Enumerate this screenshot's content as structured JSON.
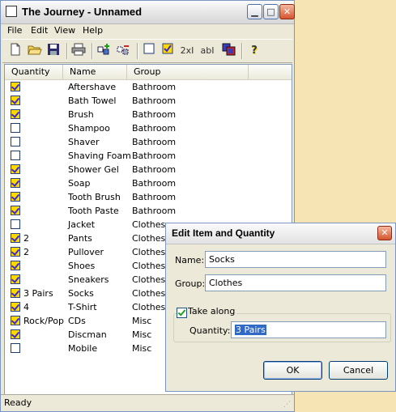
{
  "main_window": {
    "title": "The Journey - Unnamed",
    "controls": [
      "▁",
      "□",
      "✕"
    ]
  },
  "menu": [
    "File",
    "Edit",
    "View",
    "Help"
  ],
  "toolbar": {
    "icons": [
      "new-document-icon",
      "open-folder-icon",
      "save-icon",
      "print-icon",
      "add-items-icon",
      "remove-items-icon",
      "uncheck-all-icon",
      "check-all-icon",
      "quantity-icon",
      "rename-icon",
      "database-icon",
      "help-icon"
    ],
    "quantity_label": "2x",
    "rename_label": "ab",
    "help_label": "?"
  },
  "list": {
    "columns": [
      "Quantity",
      "Name",
      "Group"
    ],
    "rows": [
      {
        "checked": true,
        "quantity": "",
        "name": "Aftershave",
        "group": "Bathroom"
      },
      {
        "checked": true,
        "quantity": "",
        "name": "Bath Towel",
        "group": "Bathroom"
      },
      {
        "checked": true,
        "quantity": "",
        "name": "Brush",
        "group": "Bathroom"
      },
      {
        "checked": false,
        "quantity": "",
        "name": "Shampoo",
        "group": "Bathroom"
      },
      {
        "checked": false,
        "quantity": "",
        "name": "Shaver",
        "group": "Bathroom"
      },
      {
        "checked": false,
        "quantity": "",
        "name": "Shaving Foam",
        "group": "Bathroom"
      },
      {
        "checked": true,
        "quantity": "",
        "name": "Shower Gel",
        "group": "Bathroom"
      },
      {
        "checked": true,
        "quantity": "",
        "name": "Soap",
        "group": "Bathroom"
      },
      {
        "checked": true,
        "quantity": "",
        "name": "Tooth Brush",
        "group": "Bathroom"
      },
      {
        "checked": true,
        "quantity": "",
        "name": "Tooth Paste",
        "group": "Bathroom"
      },
      {
        "checked": false,
        "quantity": "",
        "name": "Jacket",
        "group": "Clothes"
      },
      {
        "checked": true,
        "quantity": "2",
        "name": "Pants",
        "group": "Clothes"
      },
      {
        "checked": true,
        "quantity": "2",
        "name": "Pullover",
        "group": "Clothes"
      },
      {
        "checked": true,
        "quantity": "",
        "name": "Shoes",
        "group": "Clothes"
      },
      {
        "checked": true,
        "quantity": "",
        "name": "Sneakers",
        "group": "Clothes"
      },
      {
        "checked": true,
        "quantity": "3 Pairs",
        "name": "Socks",
        "group": "Clothes"
      },
      {
        "checked": true,
        "quantity": "4",
        "name": "T-Shirt",
        "group": "Clothes"
      },
      {
        "checked": true,
        "quantity": "Rock/Pop",
        "name": "CDs",
        "group": "Misc"
      },
      {
        "checked": true,
        "quantity": "",
        "name": "Discman",
        "group": "Misc"
      },
      {
        "checked": false,
        "quantity": "",
        "name": "Mobile",
        "group": "Misc"
      }
    ]
  },
  "status": "Ready",
  "dialog": {
    "title": "Edit Item and Quantity",
    "close_label": "✕",
    "name_label": "Name:",
    "name_value": "Socks",
    "group_label": "Group:",
    "group_value": "Clothes",
    "take_along_label": "Take along",
    "take_along_checked": true,
    "quantity_label": "Quantity:",
    "quantity_value": "3 Pairs",
    "ok_label": "OK",
    "cancel_label": "Cancel"
  },
  "colors": {
    "desktop": "#f7e4b5",
    "checkbox_fill": "#ffd800",
    "checkmark": "#3a2ad1",
    "selection": "#3169c6"
  }
}
